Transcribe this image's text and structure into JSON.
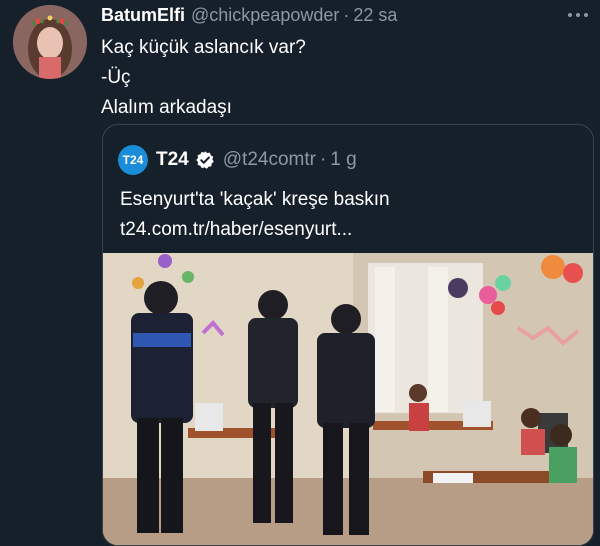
{
  "tweet": {
    "display_name": "BatumElfi",
    "handle": "@chickpeapowder",
    "separator": "·",
    "time": "22 sa",
    "avatar_icon": "avatar-photo",
    "more_icon": "more-options-icon",
    "lines": [
      "Kaç küçük aslancık var?",
      "-Üç",
      "Alalım arkadaşı"
    ]
  },
  "quote": {
    "logo_text": "T24",
    "display_name": "T24",
    "verified_icon": "verified-badge-icon",
    "handle": "@t24comtr",
    "separator": "·",
    "time": "1 g",
    "lines": [
      "Esenyurt'ta 'kaçak' kreşe baskın",
      "t24.com.tr/haber/esenyurt..."
    ],
    "media_icon": "news-photo-image"
  },
  "colors": {
    "background": "#15202b",
    "text": "#ffffff",
    "secondary_text": "#8b98a5",
    "border": "#38444d",
    "brand_t24": "#1a8cd8"
  }
}
